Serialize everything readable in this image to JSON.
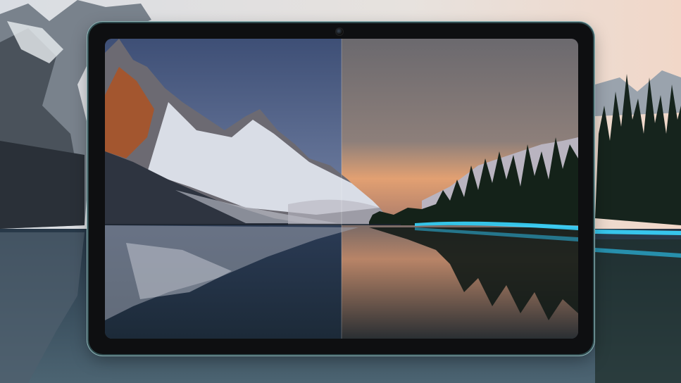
{
  "image": {
    "subject": "tablet-display-comparison",
    "colors": {
      "left_sky": "#4e5f86",
      "right_sky_top": "#6f6e73",
      "sunset_glow": "#e2a072",
      "lake_dark": "#1f3040",
      "light_trail": "#38d6ff",
      "bezel": "#0e0f11"
    }
  }
}
